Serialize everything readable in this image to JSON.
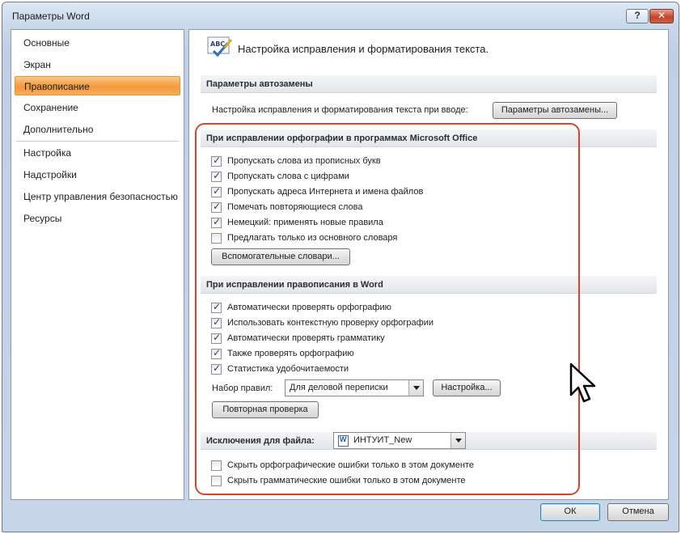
{
  "window": {
    "title": "Параметры Word",
    "help_label": "?",
    "close_label": "✕"
  },
  "nav": {
    "items": [
      {
        "label": "Основные"
      },
      {
        "label": "Экран"
      },
      {
        "label": "Правописание"
      },
      {
        "label": "Сохранение"
      },
      {
        "label": "Дополнительно"
      },
      {
        "label": "Настройка"
      },
      {
        "label": "Надстройки"
      },
      {
        "label": "Центр управления безопасностью"
      },
      {
        "label": "Ресурсы"
      }
    ],
    "active": "Правописание"
  },
  "header": {
    "icon": "abc-spelling-icon",
    "title": "Настройка исправления и форматирования текста."
  },
  "autocorrect": {
    "section_title": "Параметры автозамены",
    "description": "Настройка исправления и форматирования текста при вводе:",
    "button_label": "Параметры автозамены..."
  },
  "office_spelling": {
    "section_title": "При исправлении орфографии в программах Microsoft Office",
    "options": [
      {
        "label": "Пропускать слова из прописных букв",
        "checked": true
      },
      {
        "label": "Пропускать слова с цифрами",
        "checked": true
      },
      {
        "label": "Пропускать адреса Интернета и имена файлов",
        "checked": true
      },
      {
        "label": "Помечать повторяющиеся слова",
        "checked": true
      },
      {
        "label": "Немецкий: применять новые правила",
        "checked": true
      },
      {
        "label": "Предлагать только из основного словаря",
        "checked": false
      }
    ],
    "custom_dictionaries_label": "Вспомогательные словари..."
  },
  "word_spelling": {
    "section_title": "При исправлении правописания в Word",
    "options": [
      {
        "label": "Автоматически проверять орфографию",
        "checked": true
      },
      {
        "label": "Использовать контекстную проверку орфографии",
        "checked": true
      },
      {
        "label": "Автоматически проверять грамматику",
        "checked": true
      },
      {
        "label": "Также проверять орфографию",
        "checked": true
      },
      {
        "label": "Статистика удобочитаемости",
        "checked": true
      }
    ],
    "rules_label": "Набор правил:",
    "rules_value": "Для деловой переписки",
    "settings_label": "Настройка...",
    "recheck_label": "Повторная проверка"
  },
  "exceptions": {
    "section_title": "Исключения для файла:",
    "file_value": "ИНТУИТ_New",
    "options": [
      {
        "label": "Скрыть орфографические ошибки только в этом документе",
        "checked": false
      },
      {
        "label": "Скрыть грамматические ошибки только в этом документе",
        "checked": false
      }
    ]
  },
  "footer": {
    "ok_label": "ОК",
    "cancel_label": "Отмена"
  },
  "colors": {
    "accent_orange": "#f39a3a",
    "highlight_red": "#d9432e",
    "frame_blue": "#c6d5e8"
  }
}
